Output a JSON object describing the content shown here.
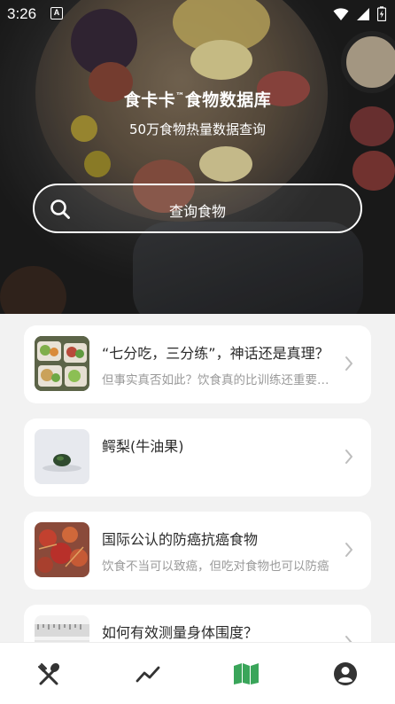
{
  "status_bar": {
    "time": "3:26",
    "notification_badge": "A"
  },
  "hero": {
    "title": "食卡卡",
    "title_mark": "™",
    "title_suffix": "食物数据库",
    "subtitle": "50万食物热量数据查询",
    "search_label": "查询食物"
  },
  "cards": [
    {
      "title": "“七分吃，三分练”，神话还是真理？",
      "desc": "但事实真否如此？饮食真的比训练还重要吗？",
      "thumb": "meal-prep-boxes"
    },
    {
      "title": "鳄梨(牛油果)",
      "desc": "",
      "thumb": "avocado"
    },
    {
      "title": "国际公认的防癌抗癌食物",
      "desc": "饮食不当可以致癌，但吃对食物也可以防癌",
      "thumb": "red-food"
    },
    {
      "title": "如何有效测量身体围度？",
      "desc": "",
      "thumb": "measuring-tape"
    }
  ],
  "tabbar": {
    "items": [
      "utensils-icon",
      "trend-icon",
      "book-icon",
      "profile-icon"
    ],
    "active_index": 2
  },
  "colors": {
    "accent": "#3aa55a",
    "inactive": "#333333"
  }
}
